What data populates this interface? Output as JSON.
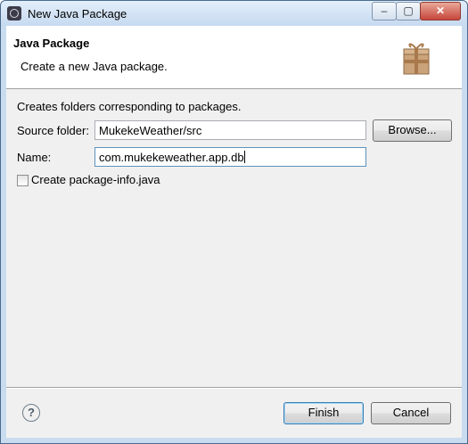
{
  "window": {
    "title": "New Java Package",
    "icon": "eclipse-icon"
  },
  "title_controls": {
    "minimize": "–",
    "maximize": "▢",
    "close": "✕"
  },
  "banner": {
    "title": "Java Package",
    "description": "Create a new Java package.",
    "icon": "package-icon"
  },
  "form": {
    "description": "Creates folders corresponding to packages.",
    "source_folder_label": "Source folder:",
    "source_folder_value": "MukekeWeather/src",
    "browse_label": "Browse...",
    "name_label": "Name:",
    "name_value": "com.mukekeweather.app.db",
    "package_info_label": "Create package-info.java",
    "package_info_checked": false
  },
  "footer": {
    "help_glyph": "?",
    "finish_label": "Finish",
    "cancel_label": "Cancel"
  }
}
